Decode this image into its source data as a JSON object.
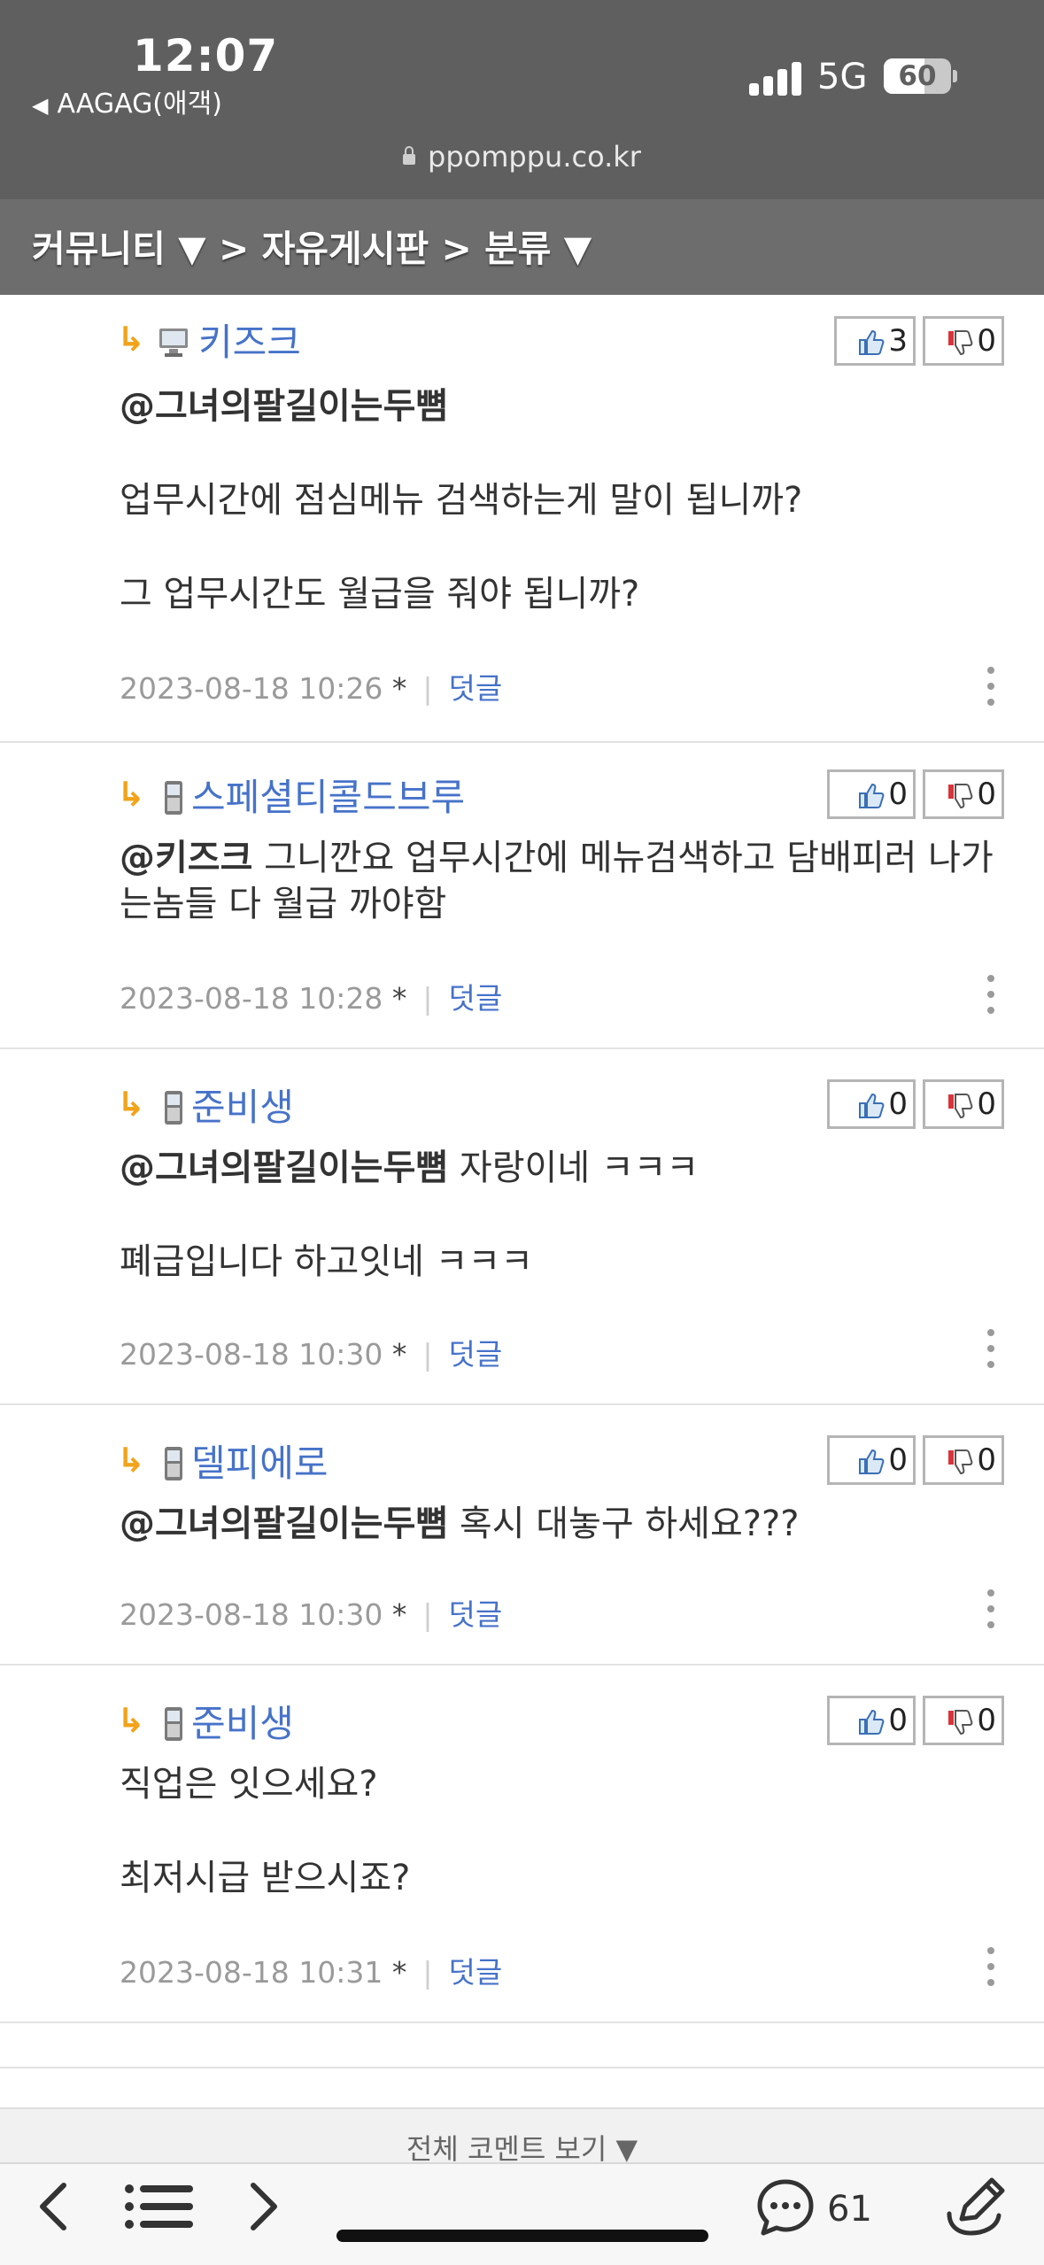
{
  "status_bar": {
    "time": "12:07",
    "back_app": "AAGAG(애객)",
    "network": "5G",
    "battery_level": "60",
    "battery_fraction": 0.6
  },
  "browser": {
    "url": "ppomppu.co.kr"
  },
  "breadcrumb": "커뮤니티 ▼ > 자유게시판 > 분류 ▼",
  "comments": [
    {
      "author": "키즈크",
      "device": "pc-icon",
      "mention": "@그녀의팔길이는두뼘",
      "lines": [
        "",
        "업무시간에 점심메뉴 검색하는게 말이 됩니까?",
        "그 업무시간도 월급을 줘야 됩니까?"
      ],
      "likes": "3",
      "dislikes": "0",
      "datetime": "2023-08-18 10:26",
      "star": "*",
      "reply_label": "덧글"
    },
    {
      "author": "스페셜티콜드브루",
      "device": "mobile-icon",
      "mention": "@키즈크",
      "lines": [
        "그니깐요 업무시간에 메뉴검색하고 담배피러 나가는놈들 다 월급 까야함"
      ],
      "likes": "0",
      "dislikes": "0",
      "datetime": "2023-08-18 10:28",
      "star": "*",
      "reply_label": "덧글"
    },
    {
      "author": "준비생",
      "device": "mobile-icon",
      "mention": "@그녀의팔길이는두뼘",
      "lines": [
        "자랑이네 ㅋㅋㅋ",
        "폐급입니다 하고잇네 ㅋㅋㅋ"
      ],
      "likes": "0",
      "dislikes": "0",
      "datetime": "2023-08-18 10:30",
      "star": "*",
      "reply_label": "덧글"
    },
    {
      "author": "델피에로",
      "device": "mobile-icon",
      "mention": "@그녀의팔길이는두뼘",
      "lines": [
        "혹시 대놓구 하세요???"
      ],
      "likes": "0",
      "dislikes": "0",
      "datetime": "2023-08-18 10:30",
      "star": "*",
      "reply_label": "덧글"
    },
    {
      "author": "준비생",
      "device": "mobile-icon",
      "mention": "",
      "lines": [
        "직업은 잇으세요?",
        "최저시급 받으시죠?"
      ],
      "likes": "0",
      "dislikes": "0",
      "datetime": "2023-08-18 10:31",
      "star": "*",
      "reply_label": "덧글"
    }
  ],
  "all_comments_label": "전체 코멘트 보기 ▼",
  "toolbar": {
    "items": [
      "back-arrow-icon",
      "list-icon",
      "forward-arrow-icon",
      "comment-bubble-icon",
      "write-icon"
    ],
    "comment_count": "61"
  },
  "colors": {
    "chrome": "#5f5f5f",
    "breadcrumb_bar": "#6d6d6d",
    "nick": "#4672c9",
    "reply_arrow": "#f2a31a"
  }
}
